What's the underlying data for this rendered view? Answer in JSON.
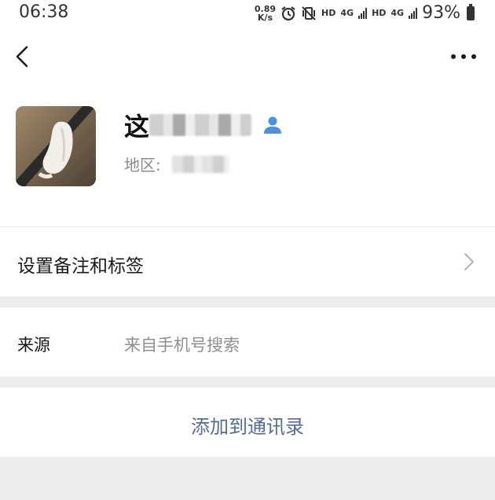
{
  "status_bar": {
    "time": "06:38",
    "net_speed_value": "0.89",
    "net_speed_unit": "K/s",
    "hd1": "HD",
    "sig1": "4G",
    "hd2": "HD",
    "sig2": "4G",
    "battery": "93%"
  },
  "profile": {
    "name_prefix": "这",
    "region_label": "地区:"
  },
  "rows": {
    "remark_label": "设置备注和标签",
    "source_label": "来源",
    "source_value": "来自手机号搜索",
    "add_label": "添加到通讯录"
  },
  "colors": {
    "link": "#576b95",
    "person_icon": "#4a90e2",
    "background": "#ededed"
  },
  "icons": {
    "back": "back-arrow-icon",
    "more": "more-dots-icon",
    "person": "person-icon",
    "chevron": "chevron-right-icon"
  }
}
